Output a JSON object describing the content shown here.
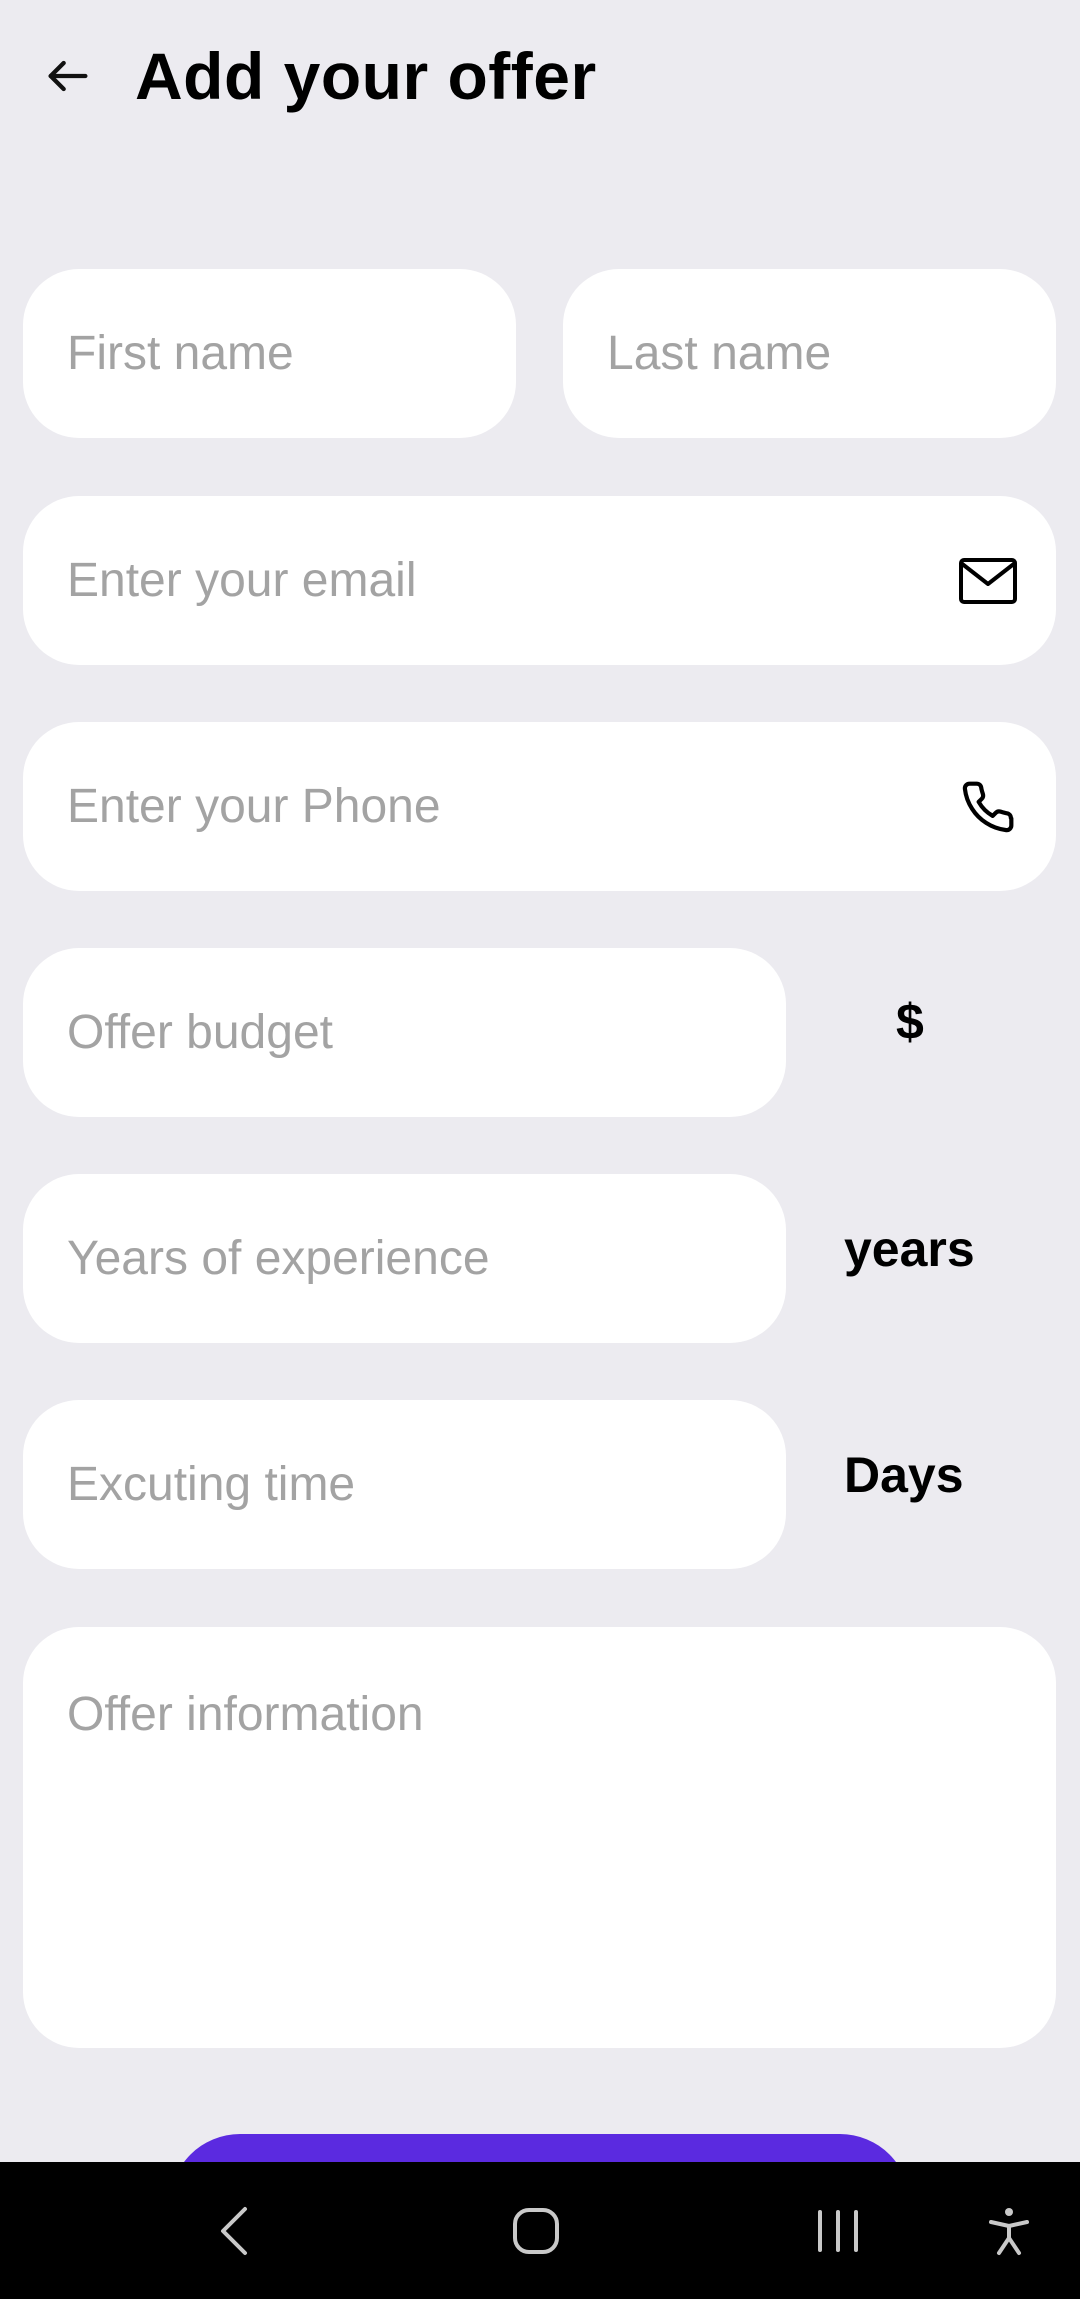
{
  "header": {
    "title": "Add your offer"
  },
  "form": {
    "first_name": {
      "placeholder": "First name",
      "value": ""
    },
    "last_name": {
      "placeholder": "Last name",
      "value": ""
    },
    "email": {
      "placeholder": "Enter your email",
      "value": "",
      "icon": "mail-icon"
    },
    "phone": {
      "placeholder": "Enter your Phone",
      "value": "",
      "icon": "phone-icon"
    },
    "budget": {
      "placeholder": "Offer budget",
      "value": "",
      "unit": "$"
    },
    "experience": {
      "placeholder": "Years of experience",
      "value": "",
      "unit": "years"
    },
    "executing_time": {
      "placeholder": "Excuting time",
      "value": "",
      "unit": "Days"
    },
    "offer_info": {
      "placeholder": "Offer information",
      "value": ""
    }
  },
  "colors": {
    "background": "#ecebf0",
    "field": "#ffffff",
    "placeholder": "#a3a3a3",
    "accent": "#5b2ae0",
    "navbar": "#000000"
  },
  "navbar": {
    "items": [
      "back-nav-icon",
      "home-nav-icon",
      "recents-nav-icon",
      "accessibility-icon"
    ]
  }
}
